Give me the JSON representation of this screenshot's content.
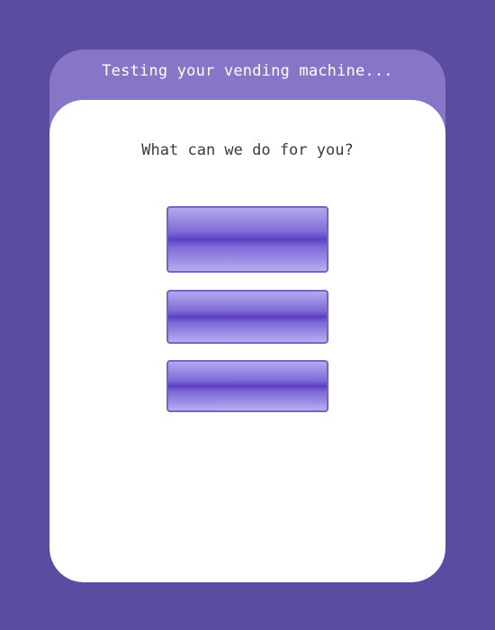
{
  "header": {
    "title": "Testing your vending machine..."
  },
  "panel": {
    "prompt": "What can we do for you?",
    "options": [
      {
        "label": ""
      },
      {
        "label": ""
      },
      {
        "label": ""
      }
    ]
  },
  "colors": {
    "background": "#5a4ca2",
    "header": "#8776c8",
    "panel": "#ffffff",
    "button_border": "#7463c9",
    "button_core": "#5d3fbf"
  }
}
